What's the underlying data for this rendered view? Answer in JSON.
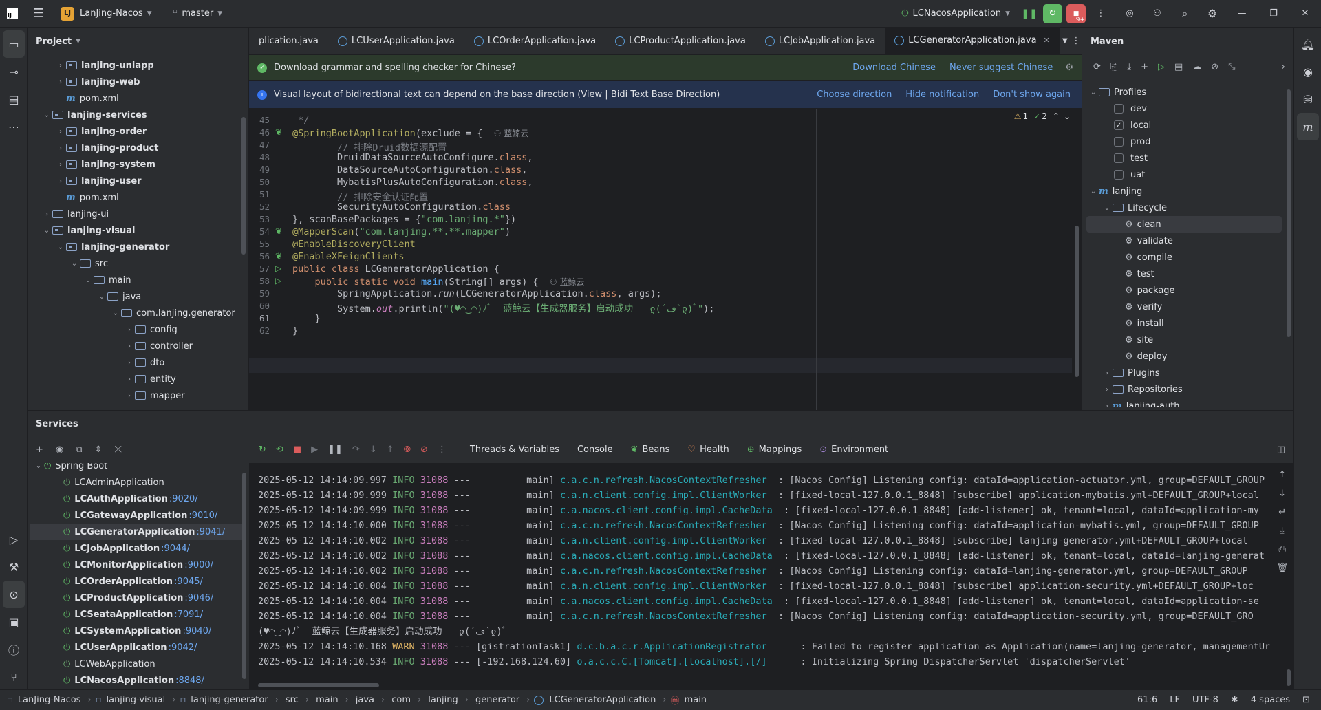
{
  "titlebar": {
    "project_initials": "LJ",
    "project_name": "LanJing-Nacos",
    "branch": "master",
    "run_config": "LCNacosApplication",
    "notification_count": "9+"
  },
  "project_panel": {
    "title": "Project",
    "items": [
      {
        "label": "lanjing-uniapp",
        "bold": true
      },
      {
        "label": "lanjing-web",
        "bold": true
      },
      {
        "label": "pom.xml"
      },
      {
        "label": "lanjing-services",
        "bold": true
      },
      {
        "label": "lanjing-order",
        "bold": true
      },
      {
        "label": "lanjing-product",
        "bold": true
      },
      {
        "label": "lanjing-system",
        "bold": true
      },
      {
        "label": "lanjing-user",
        "bold": true
      },
      {
        "label": "pom.xml"
      },
      {
        "label": "lanjing-ui"
      },
      {
        "label": "lanjing-visual",
        "bold": true
      },
      {
        "label": "lanjing-generator",
        "bold": true
      },
      {
        "label": "src"
      },
      {
        "label": "main"
      },
      {
        "label": "java"
      },
      {
        "label": "com.lanjing.generator"
      },
      {
        "label": "config"
      },
      {
        "label": "controller"
      },
      {
        "label": "dto"
      },
      {
        "label": "entity"
      },
      {
        "label": "mapper"
      }
    ]
  },
  "editor": {
    "tabs": [
      "plication.java",
      "LCUserApplication.java",
      "LCOrderApplication.java",
      "LCProductApplication.java",
      "LCJobApplication.java",
      "LCGeneratorApplication.java"
    ],
    "notif1": {
      "text": "Download grammar and spelling checker for Chinese?",
      "action1": "Download Chinese",
      "action2": "Never suggest Chinese"
    },
    "notif2": {
      "text": "Visual layout of bidirectional text can depend on the base direction (View | Bidi Text Base Direction)",
      "action1": "Choose direction",
      "action2": "Hide notification",
      "action3": "Don't show again"
    },
    "inspections": {
      "warnings": "1",
      "ok": "2"
    },
    "author_hint": "蓝鲸云",
    "line_numbers": [
      "45",
      "46",
      "47",
      "48",
      "49",
      "50",
      "51",
      "52",
      "53",
      "54",
      "55",
      "56",
      "57",
      "58",
      "59",
      "60",
      "61",
      "62"
    ],
    "lines": {
      "l45": " */",
      "l46a": "@SpringBootApplication",
      "l46b": "(exclude = {",
      "l47": "        // 排除Druid数据源配置",
      "l48a": "        DruidDataSourceAutoConfigure.",
      "l48b": "class",
      "l49a": "        DataSourceAutoConfiguration.",
      "l49b": "class",
      "l50a": "        MybatisPlusAutoConfiguration.",
      "l50b": "class",
      "l51": "        // 排除安全认证配置",
      "l52a": "        SecurityAutoConfiguration.",
      "l52b": "class",
      "l53a": "}, scanBasePackages = {",
      "l53b": "\"com.lanjing.*\"",
      "l53c": "})",
      "l54a": "@MapperScan",
      "l54b": "(",
      "l54c": "\"com.lanjing.**.**.mapper\"",
      "l54d": ")",
      "l55": "@EnableDiscoveryClient",
      "l56": "@EnableXFeignClients",
      "l57a": "public class ",
      "l57b": "LCGeneratorApplication {",
      "l58a": "    public static void ",
      "l58b": "main",
      "l58c": "(String[] args) {",
      "l59a": "        SpringApplication.",
      "l59b": "run",
      "l59c": "(LCGeneratorApplication.",
      "l59d": "class",
      "l59e": ", args);",
      "l60a": "        System.",
      "l60b": "out",
      "l60c": ".println(",
      "l60d": "\"(♥◠‿◠)ﾉﾞ  蓝鲸云【生成器服务】启动成功   ლ(´ڡ`ლ)ﾞ\"",
      "l60e": ");",
      "l61": "    }",
      "l62": "}"
    }
  },
  "maven": {
    "title": "Maven",
    "profiles_label": "Profiles",
    "profiles": [
      {
        "name": "dev",
        "checked": false
      },
      {
        "name": "local",
        "checked": true
      },
      {
        "name": "prod",
        "checked": false
      },
      {
        "name": "test",
        "checked": false
      },
      {
        "name": "uat",
        "checked": false
      }
    ],
    "project": "lanjing",
    "lifecycle_label": "Lifecycle",
    "lifecycle": [
      "clean",
      "validate",
      "compile",
      "test",
      "package",
      "verify",
      "install",
      "site",
      "deploy"
    ],
    "plugins_label": "Plugins",
    "repositories_label": "Repositories",
    "next_module": "lanjing-auth"
  },
  "services": {
    "title": "Services",
    "group": "Spring Boot",
    "apps": [
      {
        "name": "LCAdminApplication",
        "port": "",
        "running": false
      },
      {
        "name": "LCAuthApplication",
        "port": ":9020/",
        "running": true
      },
      {
        "name": "LCGatewayApplication",
        "port": ":9010/",
        "running": true
      },
      {
        "name": "LCGeneratorApplication",
        "port": ":9041/",
        "running": true,
        "selected": true
      },
      {
        "name": "LCJobApplication",
        "port": ":9044/",
        "running": true
      },
      {
        "name": "LCMonitorApplication",
        "port": ":9000/",
        "running": true
      },
      {
        "name": "LCOrderApplication",
        "port": ":9045/",
        "running": true
      },
      {
        "name": "LCProductApplication",
        "port": ":9046/",
        "running": true
      },
      {
        "name": "LCSeataApplication",
        "port": ":7091/",
        "running": true
      },
      {
        "name": "LCSystemApplication",
        "port": ":9040/",
        "running": true
      },
      {
        "name": "LCUserApplication",
        "port": ":9042/",
        "running": true
      },
      {
        "name": "LCWebApplication",
        "port": "",
        "running": false
      },
      {
        "name": "LCNacosApplication",
        "port": ":8848/",
        "running": true
      }
    ],
    "console_tabs": [
      "Threads & Variables",
      "Console",
      "Beans",
      "Health",
      "Mappings",
      "Environment"
    ],
    "logs": [
      {
        "ts": "2025-05-12 14:14:09.997",
        "level": "INFO",
        "pid": "31088",
        "thread": "         main]",
        "cls": "c.a.c.n.refresh.NacosContextRefresher",
        "msg": "  : [Nacos Config] Listening config: dataId=application-actuator.yml, group=DEFAULT_GROUP"
      },
      {
        "ts": "2025-05-12 14:14:09.999",
        "level": "INFO",
        "pid": "31088",
        "thread": "         main]",
        "cls": "c.a.n.client.config.impl.ClientWorker",
        "msg": "  : [fixed-local-127.0.0.1_8848] [subscribe] application-mybatis.yml+DEFAULT_GROUP+local"
      },
      {
        "ts": "2025-05-12 14:14:09.999",
        "level": "INFO",
        "pid": "31088",
        "thread": "         main]",
        "cls": "c.a.nacos.client.config.impl.CacheData",
        "msg": "  : [fixed-local-127.0.0.1_8848] [add-listener] ok, tenant=local, dataId=application-my"
      },
      {
        "ts": "2025-05-12 14:14:10.000",
        "level": "INFO",
        "pid": "31088",
        "thread": "         main]",
        "cls": "c.a.c.n.refresh.NacosContextRefresher",
        "msg": "  : [Nacos Config] Listening config: dataId=application-mybatis.yml, group=DEFAULT_GROUP"
      },
      {
        "ts": "2025-05-12 14:14:10.002",
        "level": "INFO",
        "pid": "31088",
        "thread": "         main]",
        "cls": "c.a.n.client.config.impl.ClientWorker",
        "msg": "  : [fixed-local-127.0.0.1_8848] [subscribe] lanjing-generator.yml+DEFAULT_GROUP+local"
      },
      {
        "ts": "2025-05-12 14:14:10.002",
        "level": "INFO",
        "pid": "31088",
        "thread": "         main]",
        "cls": "c.a.nacos.client.config.impl.CacheData",
        "msg": "  : [fixed-local-127.0.0.1_8848] [add-listener] ok, tenant=local, dataId=lanjing-generat"
      },
      {
        "ts": "2025-05-12 14:14:10.002",
        "level": "INFO",
        "pid": "31088",
        "thread": "         main]",
        "cls": "c.a.c.n.refresh.NacosContextRefresher",
        "msg": "  : [Nacos Config] Listening config: dataId=lanjing-generator.yml, group=DEFAULT_GROUP"
      },
      {
        "ts": "2025-05-12 14:14:10.004",
        "level": "INFO",
        "pid": "31088",
        "thread": "         main]",
        "cls": "c.a.n.client.config.impl.ClientWorker",
        "msg": "  : [fixed-local-127.0.0.1_8848] [subscribe] application-security.yml+DEFAULT_GROUP+loc"
      },
      {
        "ts": "2025-05-12 14:14:10.004",
        "level": "INFO",
        "pid": "31088",
        "thread": "         main]",
        "cls": "c.a.nacos.client.config.impl.CacheData",
        "msg": "  : [fixed-local-127.0.0.1_8848] [add-listener] ok, tenant=local, dataId=application-se"
      },
      {
        "ts": "2025-05-12 14:14:10.004",
        "level": "INFO",
        "pid": "31088",
        "thread": "         main]",
        "cls": "c.a.c.n.refresh.NacosContextRefresher",
        "msg": "  : [Nacos Config] Listening config: dataId=application-security.yml, group=DEFAULT_GRO"
      }
    ],
    "startup_msg": "(♥◠‿◠)ﾉﾞ  蓝鲸云【生成器服务】启动成功   ლ(´ڡ`ლ)ﾞ",
    "logs2": [
      {
        "ts": "2025-05-12 14:14:10.168",
        "level": "WARN",
        "pid": "31088",
        "thread": "[gistrationTask1]",
        "cls": "d.c.b.a.c.r.ApplicationRegistrator",
        "msg": "      : Failed to register application as Application(name=lanjing-generator, managementUr"
      },
      {
        "ts": "2025-05-12 14:14:10.534",
        "level": "INFO",
        "pid": "31088",
        "thread": "[-192.168.124.60]",
        "cls": "o.a.c.c.C.[Tomcat].[localhost].[/]",
        "msg": "      : Initializing Spring DispatcherServlet 'dispatcherServlet'"
      }
    ]
  },
  "statusbar": {
    "crumbs": [
      "LanJing-Nacos",
      "lanjing-visual",
      "lanjing-generator",
      "src",
      "main",
      "java",
      "com",
      "lanjing",
      "generator",
      "LCGeneratorApplication",
      "main"
    ],
    "position": "61:6",
    "line_sep": "LF",
    "encoding": "UTF-8",
    "indent": "4 spaces"
  }
}
